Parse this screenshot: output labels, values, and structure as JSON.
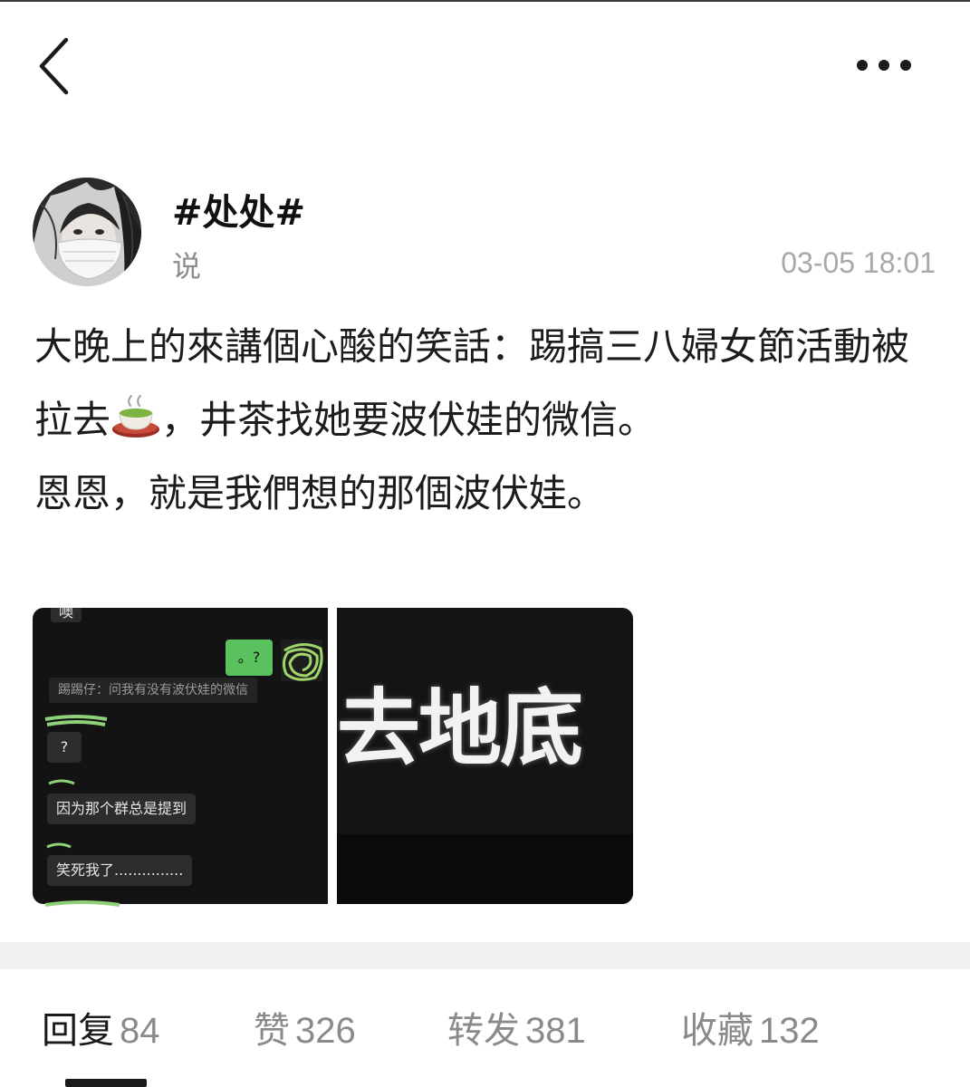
{
  "header": {
    "back_icon": "chevron-left-icon",
    "more_icon": "more-horizontal-icon"
  },
  "author": {
    "name": "#处处#",
    "subtitle": "说",
    "time": "03-05 18:01",
    "avatar_icon": "masked-woman-avatar"
  },
  "post": {
    "line1_a": "大晚上的來講個心酸的笑話：踢搞三八婦女節活動被拉去",
    "tea_icon": "tea-cup-emoji",
    "line1_b": "，井茶找她要波伏娃的微信。",
    "line2": "恩恩，就是我們想的那個波伏娃。"
  },
  "images": {
    "left": {
      "top_partial_text": "噢",
      "green_bubble": "。?",
      "system_message": "踢踢仔：问我有没有波伏娃的微信",
      "bubble_1": "?",
      "bubble_2": "因为那个群总是提到",
      "bubble_3": "笑死我了..............."
    },
    "right": {
      "caption": "去地底"
    }
  },
  "tabs": [
    {
      "label": "回复",
      "count": "84"
    },
    {
      "label": "赞",
      "count": "326"
    },
    {
      "label": "转发",
      "count": "381"
    },
    {
      "label": "收藏",
      "count": "132"
    }
  ],
  "colors": {
    "text": "#1a1a1a",
    "muted": "#8a8a8a",
    "time": "#a8a8a8",
    "divider_band": "#f3f1ef",
    "chat_bg": "#131313",
    "wechat_green": "#5ac15e"
  }
}
